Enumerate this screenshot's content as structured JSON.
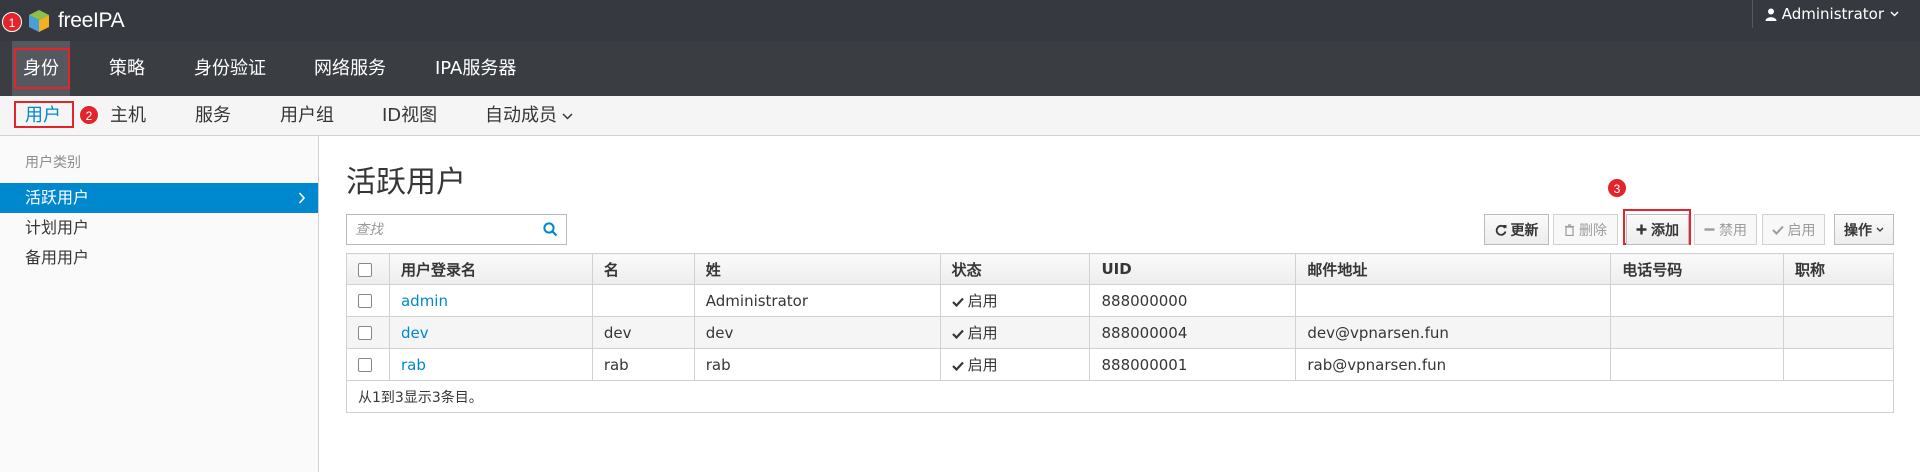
{
  "app": {
    "brand": "freeIPA",
    "user": "Administrator"
  },
  "nav_primary": [
    {
      "label": "身份",
      "active": true
    },
    {
      "label": "策略"
    },
    {
      "label": "身份验证"
    },
    {
      "label": "网络服务"
    },
    {
      "label": "IPA服务器"
    }
  ],
  "nav_secondary": [
    {
      "label": "用户",
      "active": true
    },
    {
      "label": "主机"
    },
    {
      "label": "服务"
    },
    {
      "label": "用户组"
    },
    {
      "label": "ID视图"
    },
    {
      "label": "自动成员"
    }
  ],
  "annotations": {
    "badge1": "1",
    "badge2": "2",
    "badge3": "3"
  },
  "sidebar": {
    "heading": "用户类别",
    "items": [
      {
        "label": "活跃用户",
        "active": true
      },
      {
        "label": "计划用户"
      },
      {
        "label": "备用用户"
      }
    ]
  },
  "main": {
    "title": "活跃用户",
    "search_placeholder": "查找",
    "buttons": {
      "refresh": "更新",
      "delete": "删除",
      "add": "添加",
      "disable": "禁用",
      "enable": "启用",
      "actions": "操作"
    }
  },
  "table": {
    "columns": [
      "用户登录名",
      "名",
      "姓",
      "状态",
      "UID",
      "邮件地址",
      "电话号码",
      "职称"
    ],
    "rows": [
      {
        "login": "admin",
        "first": "",
        "last": "Administrator",
        "status": "启用",
        "uid": "888000000",
        "email": "",
        "phone": "",
        "title": ""
      },
      {
        "login": "dev",
        "first": "dev",
        "last": "dev",
        "status": "启用",
        "uid": "888000004",
        "email": "dev@vpnarsen.fun",
        "phone": "",
        "title": ""
      },
      {
        "login": "rab",
        "first": "rab",
        "last": "rab",
        "status": "启用",
        "uid": "888000001",
        "email": "rab@vpnarsen.fun",
        "phone": "",
        "title": ""
      }
    ],
    "footer": "从1到3显示3条目。"
  },
  "colors": {
    "accent": "#0088ce",
    "topbar": "#363a40",
    "nav": "#3a3d42",
    "highlight": "#e3242b"
  }
}
